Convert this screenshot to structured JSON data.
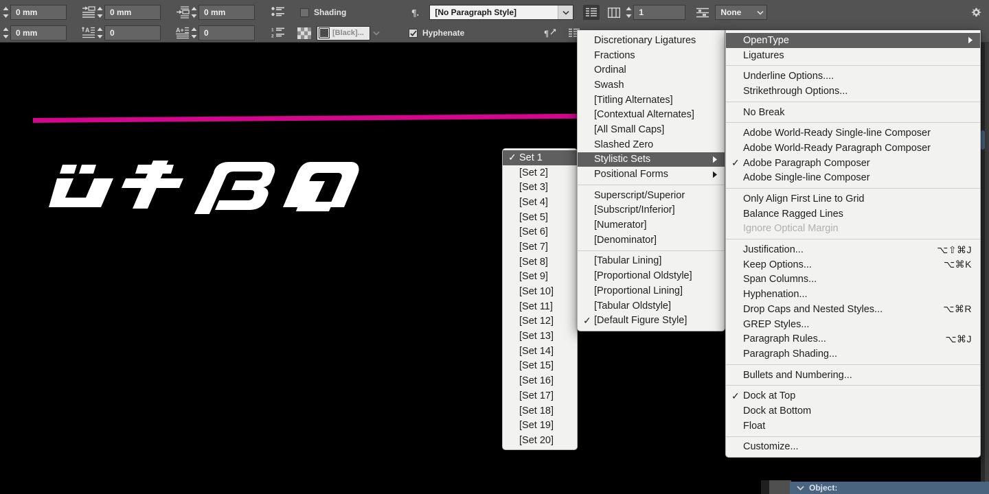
{
  "app": {
    "canvas_background": "#000000",
    "accent_magenta": "#d4068e",
    "toolbar_background": "#535353",
    "menu_background": "#f2f2f1",
    "menu_highlight": "#5f5f5f"
  },
  "control_bar": {
    "left_indent_value": "0 mm",
    "first_line_indent_value": "0 mm",
    "right_indent_value": "0 mm",
    "space_before_value": "0 mm",
    "space_after_value": "0 mm",
    "drop_cap_lines_value": "0",
    "drop_cap_chars_value": "0",
    "shading_label": "Shading",
    "shading_checked": false,
    "shading_color_value": "[Black]...",
    "paragraph_style_value": "[No Paragraph Style]",
    "hyphenate_label": "Hyphenate",
    "hyphenate_checked": true,
    "columns_value": "1",
    "grid_value": "None",
    "icons": [
      "bulleted-list-icon",
      "numbered-list-icon",
      "swatch-grid-icon",
      "paragraph-mark-icon",
      "align-left-icon",
      "columns-icon",
      "grid-align-icon",
      "gear-icon"
    ]
  },
  "glyph_preview": {
    "label": "custom-display-typeface-sample",
    "characters": [
      "u",
      "t",
      "B",
      "a"
    ]
  },
  "menus": {
    "opentype": {
      "title": "OpenType",
      "items": [
        {
          "label": "Discretionary Ligatures"
        },
        {
          "label": "Fractions"
        },
        {
          "label": "Ordinal"
        },
        {
          "label": "Swash"
        },
        {
          "label": "[Titling Alternates]"
        },
        {
          "label": "[Contextual Alternates]"
        },
        {
          "label": "[All Small Caps]"
        },
        {
          "label": "Slashed Zero"
        },
        {
          "label": "Stylistic Sets",
          "submenu": true,
          "highlighted": true
        },
        {
          "label": "Positional Forms",
          "submenu": true
        },
        {
          "separator": true
        },
        {
          "label": "Superscript/Superior"
        },
        {
          "label": "[Subscript/Inferior]"
        },
        {
          "label": "[Numerator]"
        },
        {
          "label": "[Denominator]"
        },
        {
          "separator": true
        },
        {
          "label": "[Tabular Lining]"
        },
        {
          "label": "[Proportional Oldstyle]"
        },
        {
          "label": "[Proportional Lining]"
        },
        {
          "label": "[Tabular Oldstyle]"
        },
        {
          "label": "[Default Figure Style]",
          "checked": true
        }
      ]
    },
    "stylistic_sets": {
      "items": [
        {
          "label": "Set 1",
          "checked": true,
          "highlighted": true
        },
        {
          "label": "[Set 2]"
        },
        {
          "label": "[Set 3]"
        },
        {
          "label": "[Set 4]"
        },
        {
          "label": "[Set 5]"
        },
        {
          "label": "[Set 6]"
        },
        {
          "label": "[Set 7]"
        },
        {
          "label": "[Set 8]"
        },
        {
          "label": "[Set 9]"
        },
        {
          "label": "[Set 10]"
        },
        {
          "label": "[Set 11]"
        },
        {
          "label": "[Set 12]"
        },
        {
          "label": "[Set 13]"
        },
        {
          "label": "[Set 14]"
        },
        {
          "label": "[Set 15]"
        },
        {
          "label": "[Set 16]"
        },
        {
          "label": "[Set 17]"
        },
        {
          "label": "[Set 18]"
        },
        {
          "label": "[Set 19]"
        },
        {
          "label": "[Set 20]"
        }
      ]
    },
    "paragraph_panel": {
      "items": [
        {
          "label": "OpenType",
          "submenu": true,
          "highlighted": true
        },
        {
          "label": "Ligatures"
        },
        {
          "separator": true
        },
        {
          "label": "Underline Options...."
        },
        {
          "label": "Strikethrough Options..."
        },
        {
          "separator": true
        },
        {
          "label": "No Break"
        },
        {
          "separator": true
        },
        {
          "label": "Adobe World-Ready Single-line Composer"
        },
        {
          "label": "Adobe World-Ready Paragraph Composer"
        },
        {
          "label": "Adobe Paragraph Composer",
          "checked": true
        },
        {
          "label": "Adobe Single-line Composer"
        },
        {
          "separator": true
        },
        {
          "label": "Only Align First Line to Grid"
        },
        {
          "label": "Balance Ragged Lines"
        },
        {
          "label": "Ignore Optical Margin",
          "disabled": true
        },
        {
          "separator": true
        },
        {
          "label": "Justification...",
          "shortcut": "⌥⇧⌘J"
        },
        {
          "label": "Keep Options...",
          "shortcut": "⌥⌘K"
        },
        {
          "label": "Span Columns..."
        },
        {
          "label": "Hyphenation..."
        },
        {
          "label": "Drop Caps and Nested Styles...",
          "shortcut": "⌥⌘R"
        },
        {
          "label": "GREP Styles..."
        },
        {
          "label": "Paragraph Rules...",
          "shortcut": "⌥⌘J"
        },
        {
          "label": "Paragraph Shading..."
        },
        {
          "separator": true
        },
        {
          "label": "Bullets and Numbering..."
        },
        {
          "separator": true
        },
        {
          "label": "Dock at Top",
          "checked": true
        },
        {
          "label": "Dock at Bottom"
        },
        {
          "label": "Float"
        },
        {
          "separator": true
        },
        {
          "label": "Customize..."
        }
      ]
    }
  },
  "bottom_panel": {
    "label": "Object:"
  }
}
